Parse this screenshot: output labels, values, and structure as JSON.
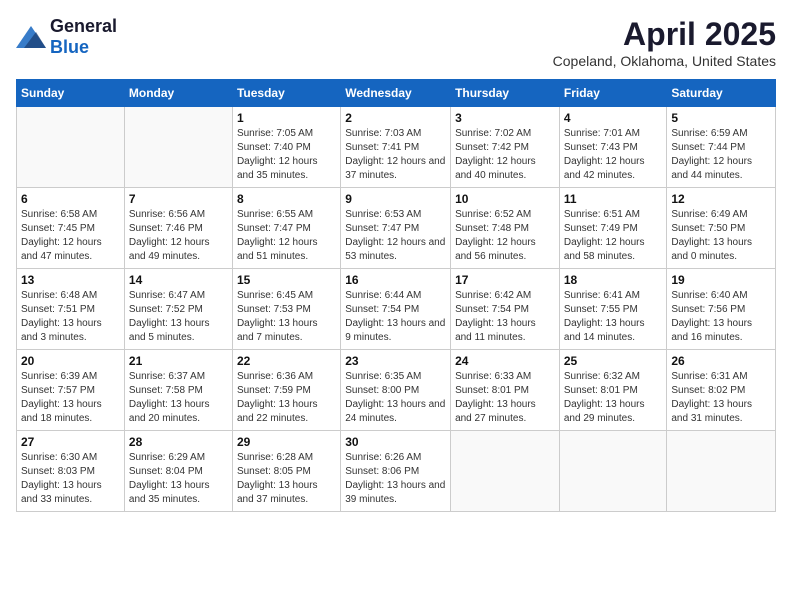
{
  "header": {
    "logo_general": "General",
    "logo_blue": "Blue",
    "title": "April 2025",
    "subtitle": "Copeland, Oklahoma, United States"
  },
  "calendar": {
    "days_of_week": [
      "Sunday",
      "Monday",
      "Tuesday",
      "Wednesday",
      "Thursday",
      "Friday",
      "Saturday"
    ],
    "weeks": [
      [
        {
          "day": "",
          "info": ""
        },
        {
          "day": "",
          "info": ""
        },
        {
          "day": "1",
          "info": "Sunrise: 7:05 AM\nSunset: 7:40 PM\nDaylight: 12 hours and 35 minutes."
        },
        {
          "day": "2",
          "info": "Sunrise: 7:03 AM\nSunset: 7:41 PM\nDaylight: 12 hours and 37 minutes."
        },
        {
          "day": "3",
          "info": "Sunrise: 7:02 AM\nSunset: 7:42 PM\nDaylight: 12 hours and 40 minutes."
        },
        {
          "day": "4",
          "info": "Sunrise: 7:01 AM\nSunset: 7:43 PM\nDaylight: 12 hours and 42 minutes."
        },
        {
          "day": "5",
          "info": "Sunrise: 6:59 AM\nSunset: 7:44 PM\nDaylight: 12 hours and 44 minutes."
        }
      ],
      [
        {
          "day": "6",
          "info": "Sunrise: 6:58 AM\nSunset: 7:45 PM\nDaylight: 12 hours and 47 minutes."
        },
        {
          "day": "7",
          "info": "Sunrise: 6:56 AM\nSunset: 7:46 PM\nDaylight: 12 hours and 49 minutes."
        },
        {
          "day": "8",
          "info": "Sunrise: 6:55 AM\nSunset: 7:47 PM\nDaylight: 12 hours and 51 minutes."
        },
        {
          "day": "9",
          "info": "Sunrise: 6:53 AM\nSunset: 7:47 PM\nDaylight: 12 hours and 53 minutes."
        },
        {
          "day": "10",
          "info": "Sunrise: 6:52 AM\nSunset: 7:48 PM\nDaylight: 12 hours and 56 minutes."
        },
        {
          "day": "11",
          "info": "Sunrise: 6:51 AM\nSunset: 7:49 PM\nDaylight: 12 hours and 58 minutes."
        },
        {
          "day": "12",
          "info": "Sunrise: 6:49 AM\nSunset: 7:50 PM\nDaylight: 13 hours and 0 minutes."
        }
      ],
      [
        {
          "day": "13",
          "info": "Sunrise: 6:48 AM\nSunset: 7:51 PM\nDaylight: 13 hours and 3 minutes."
        },
        {
          "day": "14",
          "info": "Sunrise: 6:47 AM\nSunset: 7:52 PM\nDaylight: 13 hours and 5 minutes."
        },
        {
          "day": "15",
          "info": "Sunrise: 6:45 AM\nSunset: 7:53 PM\nDaylight: 13 hours and 7 minutes."
        },
        {
          "day": "16",
          "info": "Sunrise: 6:44 AM\nSunset: 7:54 PM\nDaylight: 13 hours and 9 minutes."
        },
        {
          "day": "17",
          "info": "Sunrise: 6:42 AM\nSunset: 7:54 PM\nDaylight: 13 hours and 11 minutes."
        },
        {
          "day": "18",
          "info": "Sunrise: 6:41 AM\nSunset: 7:55 PM\nDaylight: 13 hours and 14 minutes."
        },
        {
          "day": "19",
          "info": "Sunrise: 6:40 AM\nSunset: 7:56 PM\nDaylight: 13 hours and 16 minutes."
        }
      ],
      [
        {
          "day": "20",
          "info": "Sunrise: 6:39 AM\nSunset: 7:57 PM\nDaylight: 13 hours and 18 minutes."
        },
        {
          "day": "21",
          "info": "Sunrise: 6:37 AM\nSunset: 7:58 PM\nDaylight: 13 hours and 20 minutes."
        },
        {
          "day": "22",
          "info": "Sunrise: 6:36 AM\nSunset: 7:59 PM\nDaylight: 13 hours and 22 minutes."
        },
        {
          "day": "23",
          "info": "Sunrise: 6:35 AM\nSunset: 8:00 PM\nDaylight: 13 hours and 24 minutes."
        },
        {
          "day": "24",
          "info": "Sunrise: 6:33 AM\nSunset: 8:01 PM\nDaylight: 13 hours and 27 minutes."
        },
        {
          "day": "25",
          "info": "Sunrise: 6:32 AM\nSunset: 8:01 PM\nDaylight: 13 hours and 29 minutes."
        },
        {
          "day": "26",
          "info": "Sunrise: 6:31 AM\nSunset: 8:02 PM\nDaylight: 13 hours and 31 minutes."
        }
      ],
      [
        {
          "day": "27",
          "info": "Sunrise: 6:30 AM\nSunset: 8:03 PM\nDaylight: 13 hours and 33 minutes."
        },
        {
          "day": "28",
          "info": "Sunrise: 6:29 AM\nSunset: 8:04 PM\nDaylight: 13 hours and 35 minutes."
        },
        {
          "day": "29",
          "info": "Sunrise: 6:28 AM\nSunset: 8:05 PM\nDaylight: 13 hours and 37 minutes."
        },
        {
          "day": "30",
          "info": "Sunrise: 6:26 AM\nSunset: 8:06 PM\nDaylight: 13 hours and 39 minutes."
        },
        {
          "day": "",
          "info": ""
        },
        {
          "day": "",
          "info": ""
        },
        {
          "day": "",
          "info": ""
        }
      ]
    ]
  }
}
